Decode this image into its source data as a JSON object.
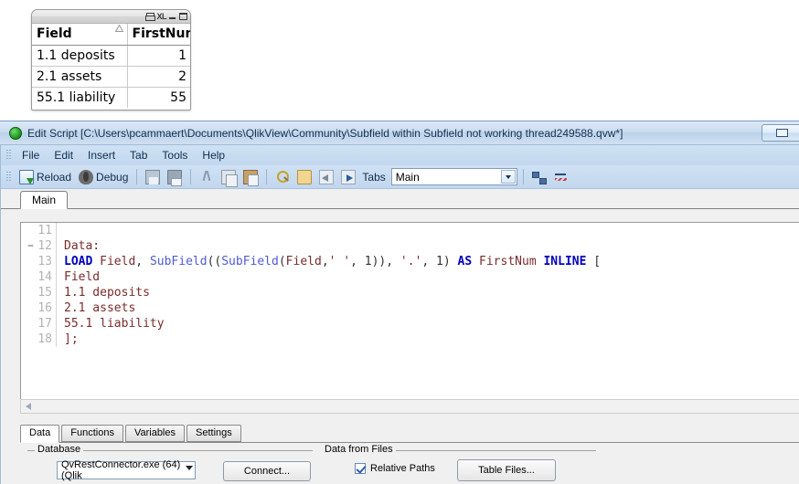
{
  "table_object": {
    "caption_buttons": [
      {
        "name": "print-icon",
        "label": ""
      },
      {
        "name": "export-excel-icon",
        "label": "XL"
      },
      {
        "name": "minimize-icon",
        "label": ""
      },
      {
        "name": "maximize-icon",
        "label": ""
      }
    ],
    "columns": [
      "Field",
      "FirstNum"
    ],
    "sort_indicator_column": "Field",
    "rows": [
      {
        "field": "1.1 deposits",
        "firstnum": "1"
      },
      {
        "field": "2.1 assets",
        "firstnum": "2"
      },
      {
        "field": "55.1 liability",
        "firstnum": "55"
      }
    ]
  },
  "window": {
    "title": "Edit Script [C:\\Users\\pcammaert\\Documents\\QlikView\\Community\\Subfield within Subfield not working thread249588.qvw*]",
    "minimize_label": ""
  },
  "menu": {
    "items": [
      "File",
      "Edit",
      "Insert",
      "Tab",
      "Tools",
      "Help"
    ]
  },
  "toolbar": {
    "reload_label": "Reload",
    "debug_label": "Debug",
    "tabs_label": "Tabs",
    "tab_selector_value": "Main",
    "tab_selector_options": [
      "Main"
    ]
  },
  "script": {
    "tab_label": "Main",
    "lines": [
      {
        "no": "11",
        "marker": false,
        "segments": []
      },
      {
        "no": "12",
        "marker": true,
        "segments": [
          {
            "t": "Data:",
            "c": "txt"
          }
        ]
      },
      {
        "no": "13",
        "marker": false,
        "segments": [
          {
            "t": "LOAD",
            "c": "kw"
          },
          {
            "t": " ",
            "c": "pl"
          },
          {
            "t": "Field",
            "c": "txt"
          },
          {
            "t": ", ",
            "c": "pl"
          },
          {
            "t": "SubField",
            "c": "fn"
          },
          {
            "t": "((",
            "c": "pl"
          },
          {
            "t": "SubField",
            "c": "fn"
          },
          {
            "t": "(",
            "c": "pl"
          },
          {
            "t": "Field",
            "c": "txt"
          },
          {
            "t": ",",
            "c": "pl"
          },
          {
            "t": "' '",
            "c": "txt"
          },
          {
            "t": ", 1)), ",
            "c": "pl"
          },
          {
            "t": "'.'",
            "c": "txt"
          },
          {
            "t": ", 1) ",
            "c": "pl"
          },
          {
            "t": "AS",
            "c": "kw"
          },
          {
            "t": " ",
            "c": "pl"
          },
          {
            "t": "FirstNum",
            "c": "txt"
          },
          {
            "t": " ",
            "c": "pl"
          },
          {
            "t": "INLINE",
            "c": "kw"
          },
          {
            "t": " [",
            "c": "pl"
          }
        ]
      },
      {
        "no": "14",
        "marker": false,
        "segments": [
          {
            "t": "Field",
            "c": "txt"
          }
        ]
      },
      {
        "no": "15",
        "marker": false,
        "segments": [
          {
            "t": "1.1 deposits",
            "c": "txt"
          }
        ]
      },
      {
        "no": "16",
        "marker": false,
        "segments": [
          {
            "t": "2.1 assets",
            "c": "txt"
          }
        ]
      },
      {
        "no": "17",
        "marker": false,
        "segments": [
          {
            "t": "55.1 liability",
            "c": "txt"
          }
        ]
      },
      {
        "no": "18",
        "marker": false,
        "segments": [
          {
            "t": "];",
            "c": "txt"
          }
        ]
      }
    ]
  },
  "bottom_tabs": {
    "items": [
      "Data",
      "Functions",
      "Variables",
      "Settings"
    ],
    "active": "Data"
  },
  "panels": {
    "database": {
      "title": "Database",
      "connector_value": "QvRestConnector.exe (64) (Qlik",
      "connect_label": "Connect..."
    },
    "data_from_files": {
      "title": "Data from Files",
      "relative_paths_label": "Relative Paths",
      "relative_paths_checked": true,
      "table_files_label": "Table Files..."
    }
  },
  "colors": {
    "title_bar": "#c7dbef",
    "code_keyword": "#0000c0",
    "code_function": "#4f5bd5",
    "code_text": "#7a2b2b",
    "accent_rule": "#3d6e84"
  }
}
